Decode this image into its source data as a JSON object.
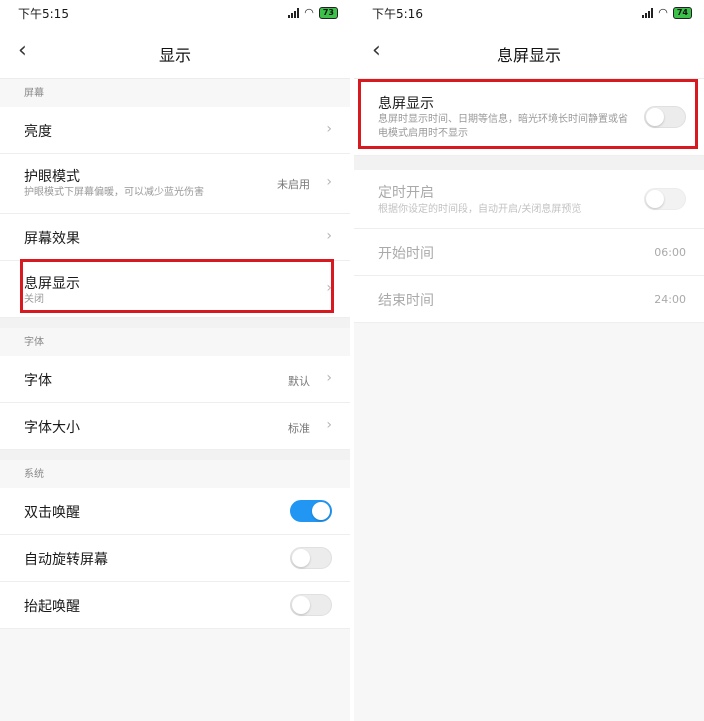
{
  "left": {
    "status": {
      "time": "下午5:15",
      "battery": "73"
    },
    "title": "显示",
    "section_screen": "屏幕",
    "brightness": "亮度",
    "eye_mode": {
      "label": "护眼模式",
      "desc": "护眼模式下屏幕偏暖，可以减少蓝光伤害",
      "value": "未启用"
    },
    "screen_effect": "屏幕效果",
    "aod": {
      "label": "息屏显示",
      "value": "关闭"
    },
    "section_font": "字体",
    "font": {
      "label": "字体",
      "value": "默认"
    },
    "font_size": {
      "label": "字体大小",
      "value": "标准"
    },
    "section_system": "系统",
    "double_tap": {
      "label": "双击唤醒",
      "on": true
    },
    "auto_rotate": {
      "label": "自动旋转屏幕",
      "on": false
    },
    "raise_wake": {
      "label": "抬起唤醒",
      "on": false
    }
  },
  "right": {
    "status": {
      "time": "下午5:16",
      "battery": "74"
    },
    "title": "息屏显示",
    "aod": {
      "label": "息屏显示",
      "desc": "息屏时显示时间、日期等信息，暗光环境长时间静置或省电模式启用时不显示",
      "on": false
    },
    "schedule": {
      "label": "定时开启",
      "desc": "根据你设定的时间段，自动开启/关闭息屏预览",
      "on": false
    },
    "start_time": {
      "label": "开始时间",
      "value": "06:00"
    },
    "end_time": {
      "label": "结束时间",
      "value": "24:00"
    }
  },
  "colors": {
    "toggle_on": "#2196f3",
    "highlight": "#d8191f"
  }
}
